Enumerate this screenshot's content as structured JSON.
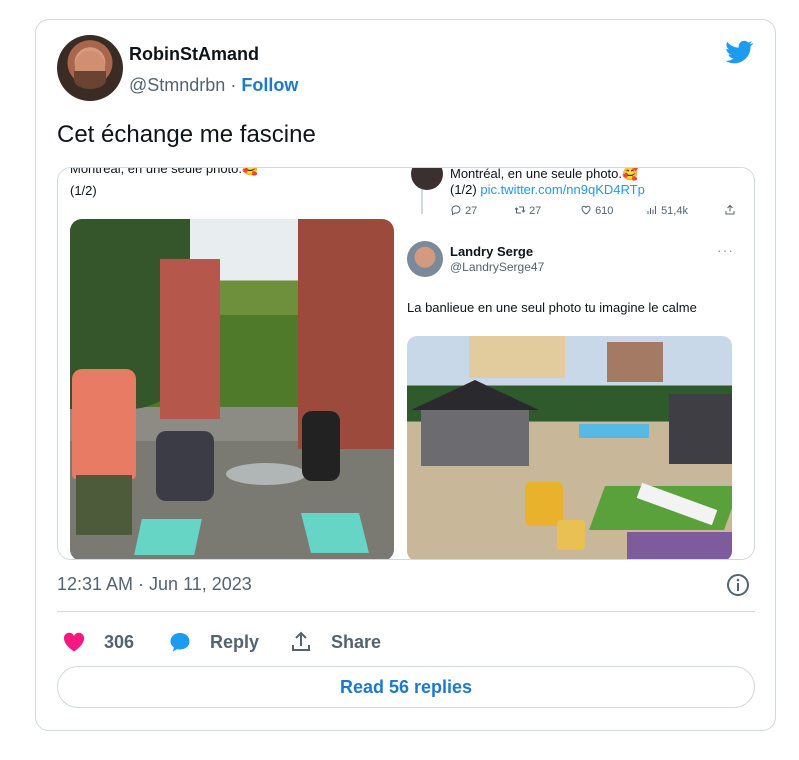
{
  "author": {
    "name": "RobinStAmand",
    "handle": "@Stmndrbn",
    "separator": "·",
    "follow_label": "Follow"
  },
  "tweet": {
    "text": "Cet échange me fascine",
    "timestamp": "12:31 AM · Jun 11, 2023"
  },
  "embedded": {
    "left": {
      "line1": "Montréal, en une seule photo.🥰",
      "line2": "(1/2)"
    },
    "right": {
      "quoted_line1": "Montréal, en une seule photo.🥰",
      "quoted_line2_prefix": "(1/2) ",
      "quoted_link": "pic.twitter.com/nn9qKD4RTp",
      "stats": {
        "replies": "27",
        "retweets": "27",
        "likes": "610",
        "views": "51,4k"
      },
      "reply_author_name": "Landry Serge",
      "reply_author_handle": "@LandrySerge47",
      "more": "···",
      "reply_text": "La banlieue en une seul photo tu imagine le calme"
    }
  },
  "actions": {
    "likes_count": "306",
    "reply_label": "Reply",
    "share_label": "Share",
    "read_replies_label": "Read 56 replies"
  },
  "colors": {
    "accent": "#1d7ac9",
    "twitter_blue": "#1d9bf0",
    "heart": "#f91880",
    "muted": "#536471",
    "border": "#cfd9de"
  },
  "icons": {
    "bird": "twitter-bird-icon",
    "info": "info-icon",
    "heart": "heart-icon",
    "reply": "reply-bubble-icon",
    "share": "share-icon"
  }
}
